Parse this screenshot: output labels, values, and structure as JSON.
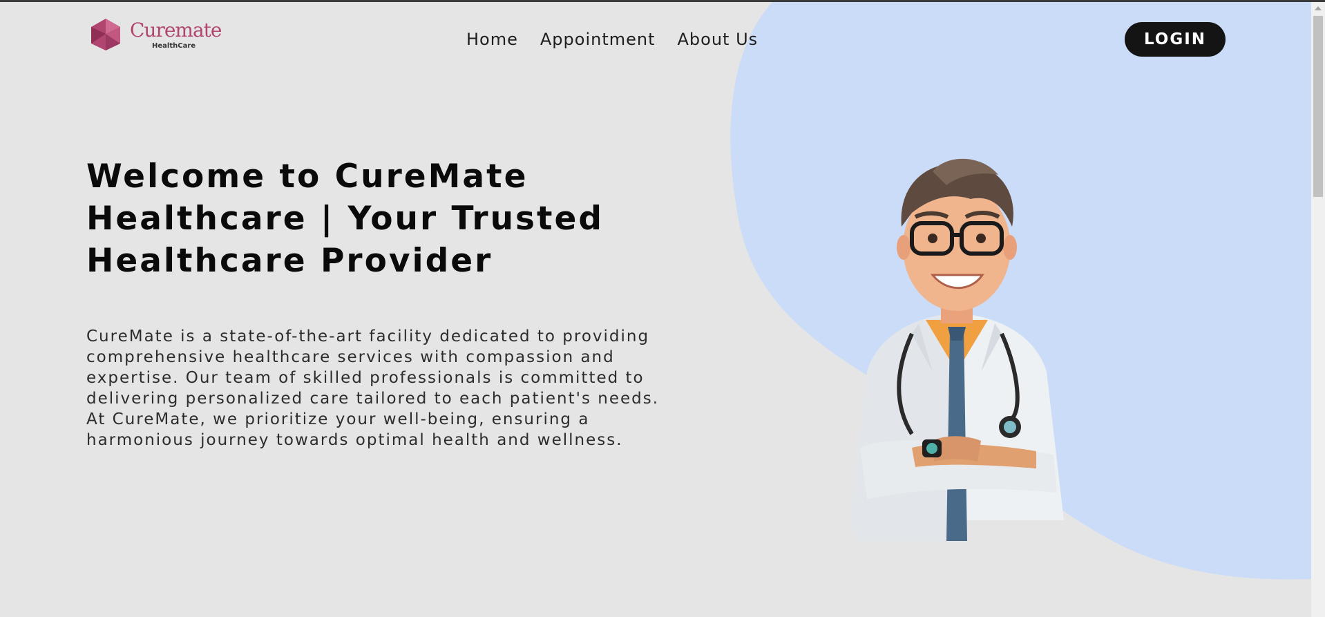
{
  "brand": {
    "name": "Curemate",
    "tagline": "HealthCare"
  },
  "nav": {
    "items": [
      {
        "label": "Home"
      },
      {
        "label": "Appointment"
      },
      {
        "label": "About Us"
      }
    ],
    "login_label": "LOGIN"
  },
  "hero": {
    "title_line1": "Welcome to CureMate",
    "title_line2": "Healthcare | Your Trusted",
    "title_line3": "Healthcare Provider",
    "description": "CureMate is a state-of-the-art facility dedicated to providing comprehensive healthcare services with compassion and expertise. Our team of skilled professionals is committed to delivering personalized care tailored to each patient's needs. At CureMate, we prioritize your well-being, ensuring a harmonious journey towards optimal health and wellness."
  },
  "colors": {
    "background": "#e5e5e5",
    "accent_blob": "#cadcf7",
    "brand": "#b0466f",
    "button": "#141414"
  },
  "icons": {
    "logo": "hexagon-gem-icon",
    "illustration": "doctor-illustration"
  }
}
